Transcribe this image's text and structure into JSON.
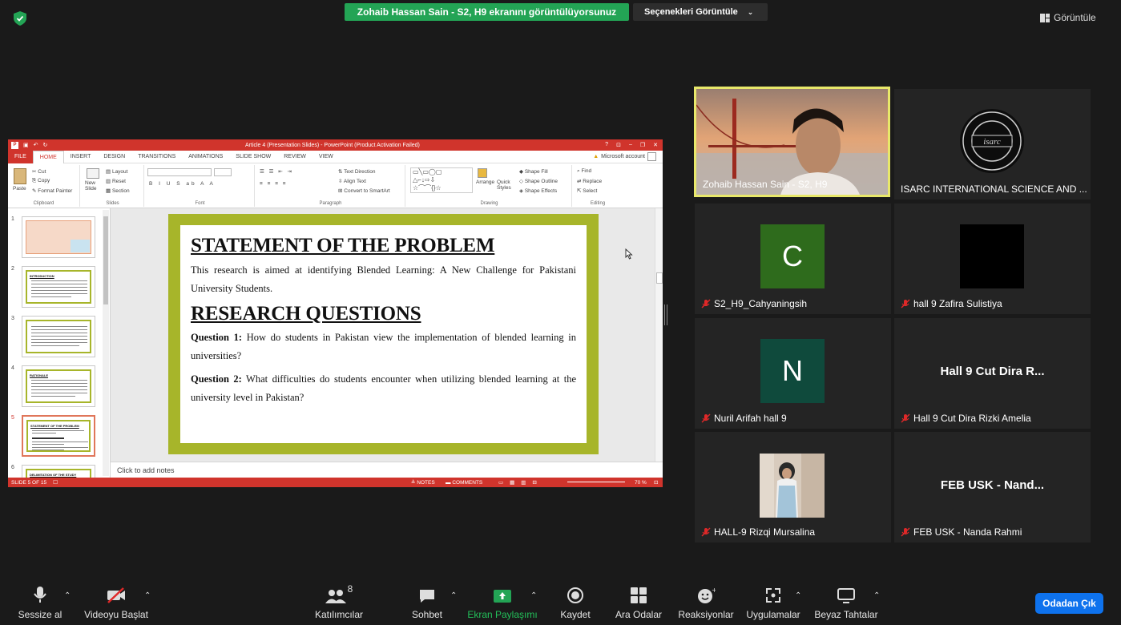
{
  "banner": {
    "sharing_text": "Zohaib Hassan Sain - S2, H9 ekranını görüntülüyorsunuz",
    "view_options": "Seçenekleri Görüntüle",
    "view_button": "Görüntüle"
  },
  "ppt": {
    "title": "Article 4 (Presentation Slides) - PowerPoint (Product Activation Failed)",
    "window_controls": [
      "?",
      "⊡",
      "–",
      "❐",
      "✕"
    ],
    "tabs": [
      "FILE",
      "HOME",
      "INSERT",
      "DESIGN",
      "TRANSITIONS",
      "ANIMATIONS",
      "SLIDE SHOW",
      "REVIEW",
      "VIEW"
    ],
    "account": "Microsoft account",
    "ribbon": {
      "clipboard": {
        "label": "Clipboard",
        "paste": "Paste",
        "cut": "Cut",
        "copy": "Copy",
        "format_painter": "Format Painter"
      },
      "slides": {
        "label": "Slides",
        "new_slide": "New Slide",
        "layout": "Layout",
        "reset": "Reset",
        "section": "Section"
      },
      "font": {
        "label": "Font"
      },
      "paragraph": {
        "label": "Paragraph",
        "text_direction": "Text Direction",
        "align_text": "Align Text",
        "convert_smartart": "Convert to SmartArt"
      },
      "drawing": {
        "label": "Drawing",
        "arrange": "Arrange",
        "quick_styles": "Quick Styles",
        "shape_fill": "Shape Fill",
        "shape_outline": "Shape Outline",
        "shape_effects": "Shape Effects"
      },
      "editing": {
        "label": "Editing",
        "find": "Find",
        "replace": "Replace",
        "select": "Select"
      }
    },
    "thumbnails": [
      {
        "num": "1",
        "title": ""
      },
      {
        "num": "2",
        "title": "INTRODUCTION"
      },
      {
        "num": "3",
        "title": ""
      },
      {
        "num": "4",
        "title": "RATIONALE"
      },
      {
        "num": "5",
        "title": "STATEMENT OF THE PROBLEM"
      },
      {
        "num": "6",
        "title": "DELIMITATION OF THE STUDY"
      }
    ],
    "slide": {
      "heading1": "STATEMENT OF THE PROBLEM",
      "para1": "This research is aimed at identifying Blended Learning: A New Challenge for Pakistani University Students.",
      "heading2": "RESEARCH QUESTIONS",
      "q1_label": "Question 1:",
      "q1_text": " How do students in Pakistan view the implementation of blended learning in universities?",
      "q2_label": "Question 2:",
      "q2_text": " What difficulties do students encounter when utilizing blended learning at the university level in Pakistan?"
    },
    "notes_placeholder": "Click to add notes",
    "status": {
      "slide_of": "SLIDE 5 OF 15",
      "notes": "NOTES",
      "comments": "COMMENTS",
      "zoom": "70 %"
    }
  },
  "participants": [
    {
      "name": "Zohaib Hassan Sain - S2, H9",
      "muted": false,
      "type": "video"
    },
    {
      "name": "ISARC INTERNATIONAL SCIENCE AND ...",
      "muted": false,
      "type": "logo"
    },
    {
      "name": "S2_H9_Cahyaningsih",
      "muted": true,
      "type": "letter",
      "letter": "C",
      "color": "#2e6b1c"
    },
    {
      "name": "hall 9 Zafira Sulistiya",
      "muted": true,
      "type": "black"
    },
    {
      "name": "Nuril Arifah hall 9",
      "muted": true,
      "type": "letter",
      "letter": "N",
      "color": "#0f4a3c"
    },
    {
      "name": "Hall 9 Cut Dira Rizki Amelia",
      "muted": true,
      "type": "bigname",
      "big": "Hall 9 Cut Dira R..."
    },
    {
      "name": "HALL-9 Rizqi Mursalina",
      "muted": true,
      "type": "photo"
    },
    {
      "name": "FEB USK - Nanda Rahmi",
      "muted": true,
      "type": "bigname",
      "big": "FEB USK - Nand..."
    }
  ],
  "toolbar": {
    "mute": "Sessize al",
    "video": "Videoyu Başlat",
    "participants": "Katılımcılar",
    "participants_count": "8",
    "chat": "Sohbet",
    "share": "Ekran Paylaşımı",
    "record": "Kaydet",
    "breakout": "Ara Odalar",
    "reactions": "Reaksiyonlar",
    "apps": "Uygulamalar",
    "whiteboards": "Beyaz Tahtalar",
    "leave": "Odadan Çık"
  },
  "colors": {
    "share_green": "#23a455",
    "leave_blue": "#0e72ed",
    "ppt_red": "#d0342c",
    "slide_border": "#a7b52a",
    "active_speaker": "#e8e86a"
  }
}
